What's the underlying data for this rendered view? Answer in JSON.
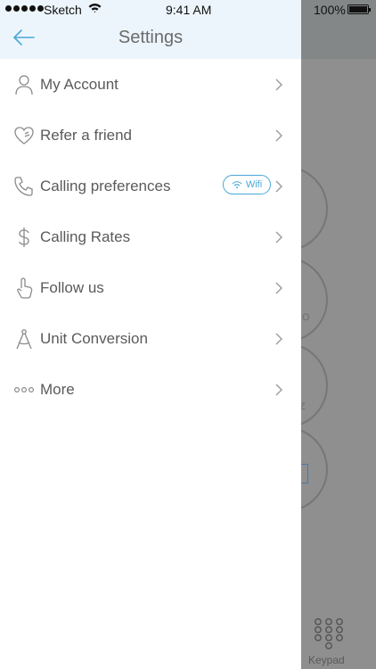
{
  "status_bar": {
    "carrier": "Sketch",
    "time": "9:41 AM",
    "battery": "100%"
  },
  "header": {
    "title": "Settings",
    "back_icon": "arrow-left-icon"
  },
  "menu": {
    "items": [
      {
        "label": "My Account",
        "icon": "user-icon"
      },
      {
        "label": "Refer a friend",
        "icon": "heart-hand-icon"
      },
      {
        "label": "Calling preferences",
        "icon": "phone-icon",
        "badge": "Wifi"
      },
      {
        "label": "Calling Rates",
        "icon": "dollar-icon"
      },
      {
        "label": "Follow us",
        "icon": "pointer-hand-icon"
      },
      {
        "label": "Unit Conversion",
        "icon": "compass-icon"
      },
      {
        "label": "More",
        "icon": "more-dots-icon"
      }
    ]
  },
  "background_app": {
    "keypad_label": "Keypad",
    "mini_text_1": "O",
    "mini_text_2": "Z"
  },
  "colors": {
    "accent": "#4aa8d8",
    "header_bg": "#ecf5fb",
    "overlay": "#8f8f8f",
    "text": "#5a5a5a"
  }
}
